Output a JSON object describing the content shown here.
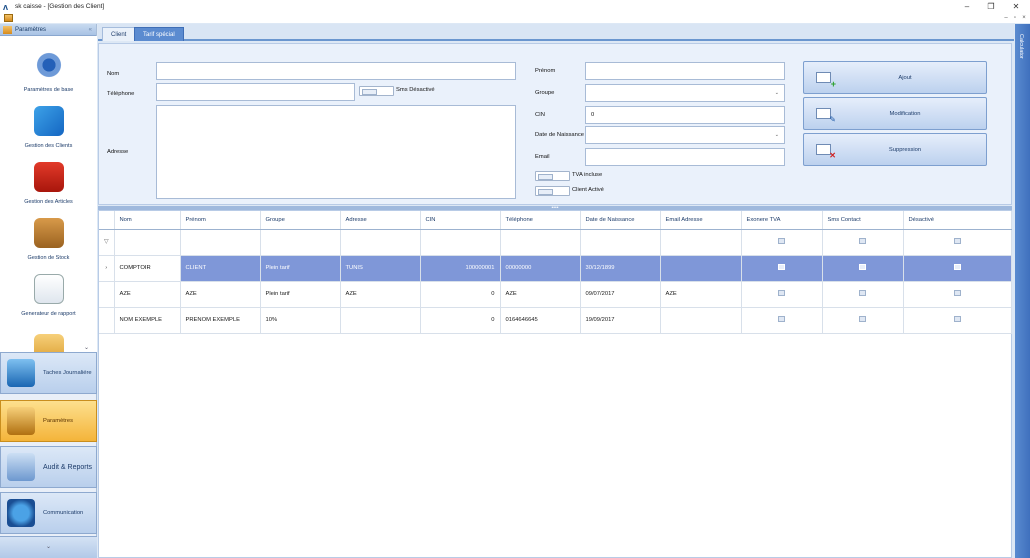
{
  "window": {
    "title": "sk caisse - [Gestion des Client]",
    "minimize": "–",
    "restore": "❐",
    "close": "✕"
  },
  "mdi": {
    "minimize": "–",
    "restore": "▫",
    "close": "×"
  },
  "sidebar": {
    "header": "Paramètres",
    "collapse": "«",
    "items": [
      {
        "label": "Paramètres de base",
        "icon": "settings-gear-icon"
      },
      {
        "label": "Gestion des Clients",
        "icon": "clients-icon"
      },
      {
        "label": "Gestion des Articles",
        "icon": "basket-icon"
      },
      {
        "label": "Gestion de Stock",
        "icon": "forklift-icon"
      },
      {
        "label": "Generateur de rapport",
        "icon": "report-icon"
      }
    ],
    "scroll_more": "⌄",
    "groups": [
      {
        "label": "Taches Journaliére",
        "icon": "calendar-clock-icon"
      },
      {
        "label": "Paramètres",
        "icon": "tools-icon",
        "active": true
      },
      {
        "label": "Audit & Reports",
        "icon": "audit-icon"
      },
      {
        "label": "Communication",
        "icon": "globe-icon"
      }
    ],
    "bottom": "⌄"
  },
  "tabs": [
    {
      "label": "Client"
    },
    {
      "label": "Tarif spécial"
    }
  ],
  "form": {
    "nom_label": "Nom",
    "nom_value": "",
    "telephone_label": "Téléphone",
    "telephone_value": "",
    "sms_label": "Sms Désactivé",
    "adresse_label": "Adresse",
    "adresse_value": "",
    "prenom_label": "Prénom",
    "prenom_value": "",
    "groupe_label": "Groupe",
    "groupe_value": "",
    "cin_label": "CIN",
    "cin_value": "0",
    "dob_label": "Date de Naissance",
    "dob_value": "",
    "email_label": "Email",
    "email_value": "",
    "tva_label": "TVA incluse",
    "active_label": "Client Activé",
    "dropdown_caret": "⌄"
  },
  "actions": {
    "ajout": "Ajout",
    "modification": "Modification",
    "suppression": "Suppression"
  },
  "splitter": "••••",
  "grid": {
    "columns": [
      "Nom",
      "Prénom",
      "Groupe",
      "Adresse",
      "CIN",
      "Téléphone",
      "Date de Naissance",
      "Email Adresse",
      "Exonere TVA",
      "Sms Contact",
      "Désactivé"
    ],
    "filter_icon": "▽",
    "row_indicator": "›",
    "rows": [
      {
        "nom": "COMPTOIR",
        "prenom": "CLIENT",
        "groupe": "Plein tarif",
        "adresse": "TUNIS",
        "cin": "100000001",
        "telephone": "00000000",
        "dob": "30/12/1899",
        "email": ""
      },
      {
        "nom": "AZE",
        "prenom": "AZE",
        "groupe": "Plein tarif",
        "adresse": "AZE",
        "cin": "0",
        "telephone": "AZE",
        "dob": "09/07/2017",
        "email": "AZE"
      },
      {
        "nom": "NOM EXEMPLE",
        "prenom": "PRENOM EXEMPLE",
        "groupe": "10%",
        "adresse": "",
        "cin": "0",
        "telephone": "0164646645",
        "dob": "19/09/2017",
        "email": ""
      }
    ]
  },
  "right_panel": {
    "label": "Calculator"
  }
}
